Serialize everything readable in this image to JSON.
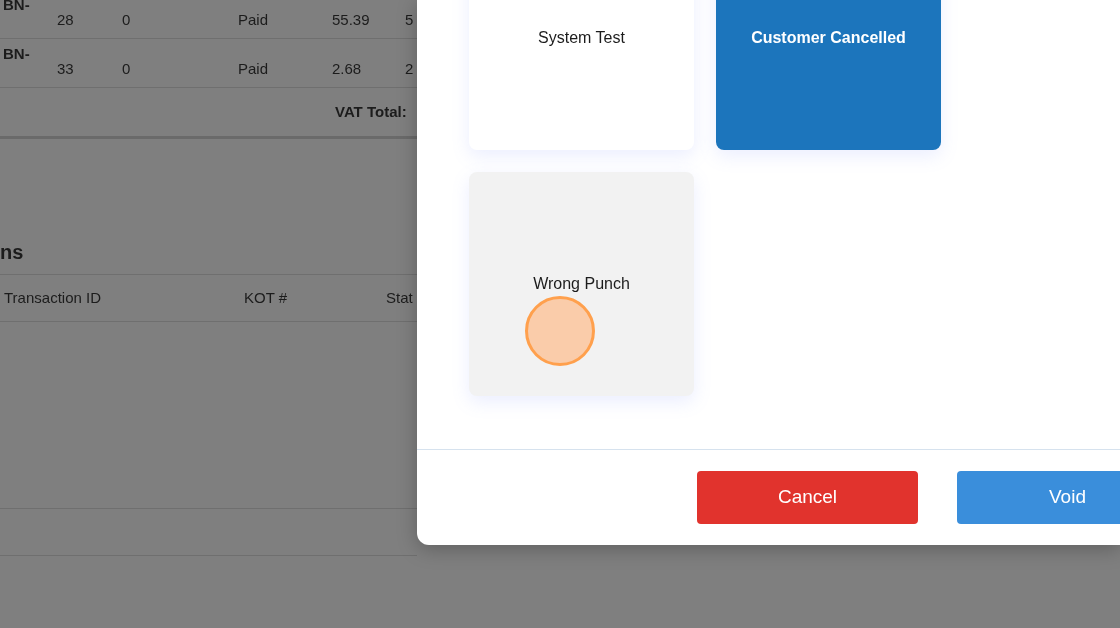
{
  "background_page": {
    "orders_table": {
      "rows": [
        {
          "bill": "BN-",
          "column_2": "28",
          "column_3": "0",
          "status": "Paid",
          "column_5": "55.39",
          "column_6": "5"
        },
        {
          "bill": "BN-",
          "column_2": "33",
          "column_3": "0",
          "status": "Paid",
          "column_5": "2.68",
          "column_6": "2"
        }
      ],
      "vat_total_label": "VAT Total:"
    },
    "section_heading": "ns",
    "transactions_table": {
      "columns": [
        "Transaction ID",
        "KOT #",
        "Stat"
      ]
    }
  },
  "void_dialog": {
    "reasons": [
      {
        "label": "System Test",
        "selected": false,
        "hovered": false
      },
      {
        "label": "Customer Cancelled",
        "selected": true,
        "hovered": false
      },
      {
        "label": "Wrong Punch",
        "selected": false,
        "hovered": true
      }
    ],
    "buttons": [
      {
        "label": "Cancel",
        "kind": "cancel"
      },
      {
        "label": "Void",
        "kind": "confirm"
      }
    ]
  }
}
